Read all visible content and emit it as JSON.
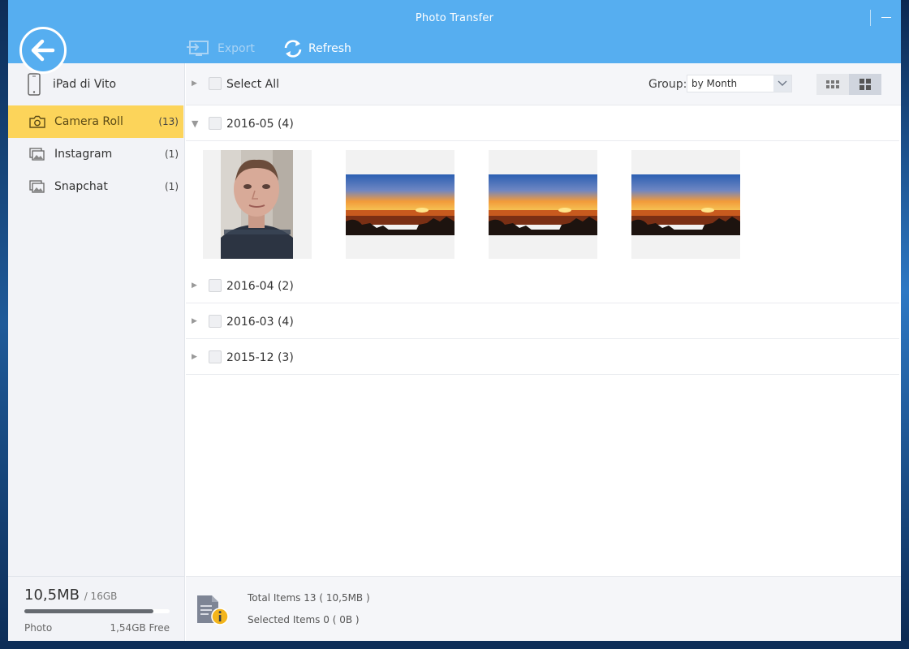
{
  "window": {
    "title": "Photo Transfer"
  },
  "toolbar": {
    "export_label": "Export",
    "refresh_label": "Refresh"
  },
  "sidebar": {
    "device_name": "iPad di Vito",
    "items": [
      {
        "label": "Camera Roll",
        "count": "(13)",
        "icon": "camera-icon",
        "active": true
      },
      {
        "label": "Instagram",
        "count": "(1)",
        "icon": "album-icon",
        "active": false
      },
      {
        "label": "Snapchat",
        "count": "(1)",
        "icon": "album-icon",
        "active": false
      }
    ],
    "storage": {
      "used": "10,5MB",
      "total": "/ 16GB",
      "type": "Photo",
      "free": "1,54GB Free"
    }
  },
  "main": {
    "select_all_label": "Select All",
    "group_label": "Group:",
    "group_value": "by Month",
    "groups": [
      {
        "name": "2016-05",
        "count": "(4)",
        "expanded": true
      },
      {
        "name": "2016-04",
        "count": "(2)",
        "expanded": false
      },
      {
        "name": "2016-03",
        "count": "(4)",
        "expanded": false
      },
      {
        "name": "2015-12",
        "count": "(3)",
        "expanded": false
      }
    ],
    "thumbnails": [
      {
        "kind": "portrait-selfie"
      },
      {
        "kind": "sunset-landscape"
      },
      {
        "kind": "sunset-landscape"
      },
      {
        "kind": "sunset-landscape"
      }
    ]
  },
  "status": {
    "total_items_label": "Total Items",
    "total_items_value": "13",
    "total_items_size": "( 10,5MB )",
    "selected_items_label": "Selected Items",
    "selected_items_value": "0",
    "selected_items_size": "( 0B )"
  }
}
